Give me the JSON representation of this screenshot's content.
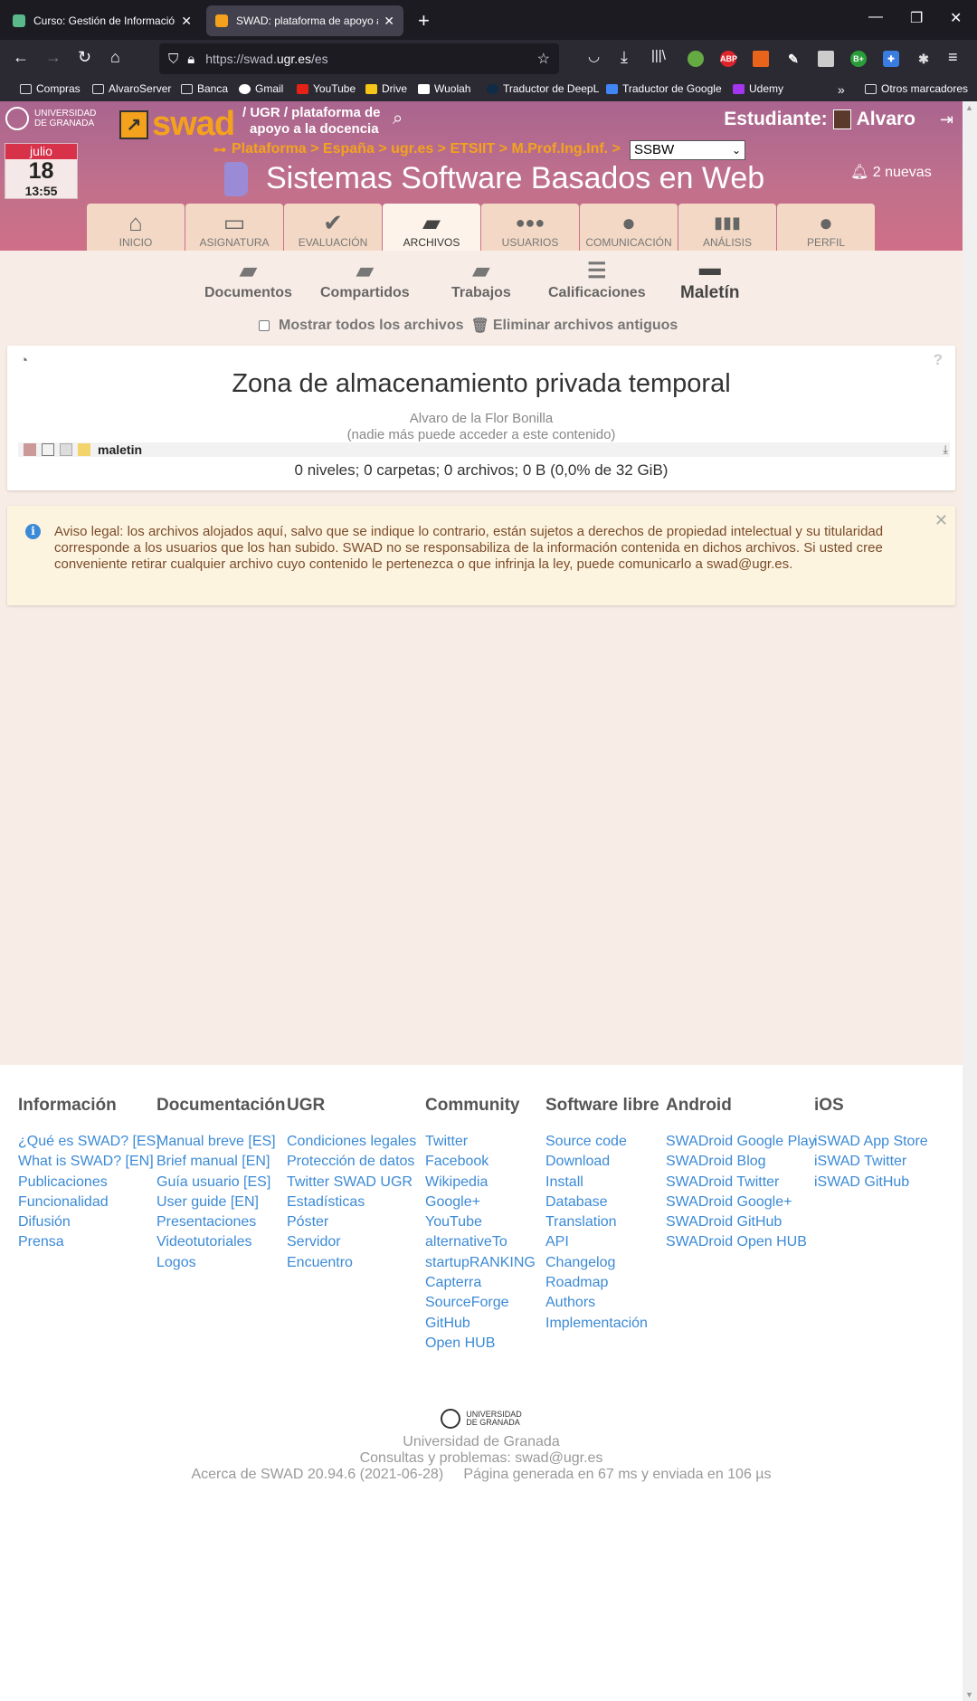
{
  "browser": {
    "tabs": [
      {
        "title": "Curso: Gestión de Información en",
        "favicon_color": "#5ab88a"
      },
      {
        "title": "SWAD: plataforma de apoyo a la doc",
        "favicon_color": "#f4a21d"
      }
    ],
    "url_prefix": "https://swad.",
    "url_domain": "ugr.es",
    "url_suffix": "/es",
    "bookmarks": [
      "Compras",
      "AlvaroServer",
      "Banca",
      "Gmail",
      "YouTube",
      "Drive",
      "Wuolah",
      "Traductor de DeepL",
      "Traductor de Google",
      "Udemy"
    ],
    "other_bookmarks": "Otros marcadores"
  },
  "header": {
    "university": "UNIVERSIDAD DE GRANADA",
    "university_l1": "UNIVERSIDAD",
    "university_l2": "DE GRANADA",
    "logo_word": "swad",
    "tagline_l1": "/ UGR / plataforma de",
    "tagline_l2": "apoyo a la docencia",
    "student_label": "Estudiante:",
    "student_name": "Alvaro",
    "calendar": {
      "month": "julio",
      "day": "18",
      "time": "13:55"
    },
    "breadcrumb": "Plataforma > España > ugr.es > ETSIIT > M.Prof.Ing.Inf. >",
    "course_select": "SSBW",
    "course_title": "Sistemas Software Basados en Web",
    "notifications": "2 nuevas"
  },
  "main_menu": [
    {
      "label": "INICIO",
      "icon": "home-icon",
      "glyph": "⌂"
    },
    {
      "label": "ASIGNATURA",
      "icon": "chalkboard-icon",
      "glyph": "▭"
    },
    {
      "label": "EVALUACIÓN",
      "icon": "check-icon",
      "glyph": "✔"
    },
    {
      "label": "ARCHIVOS",
      "icon": "folder-open-icon",
      "glyph": "▰"
    },
    {
      "label": "USUARIOS",
      "icon": "users-icon",
      "glyph": "●●"
    },
    {
      "label": "COMUNICACIÓN",
      "icon": "comment-icon",
      "glyph": "●"
    },
    {
      "label": "ANÁLISIS",
      "icon": "bar-chart-icon",
      "glyph": "▮▮"
    },
    {
      "label": "PERFIL",
      "icon": "user-icon",
      "glyph": "●"
    }
  ],
  "sub_menu": [
    {
      "label": "Documentos"
    },
    {
      "label": "Compartidos"
    },
    {
      "label": "Trabajos"
    },
    {
      "label": "Calificaciones"
    },
    {
      "label": "Maletín"
    }
  ],
  "options": {
    "show_all": "Mostrar todos los archivos",
    "delete_old": "Eliminar archivos antiguos"
  },
  "storage": {
    "title": "Zona de almacenamiento privada temporal",
    "owner": "Alvaro de la Flor Bonilla",
    "privacy": "(nadie más puede acceder a este contenido)",
    "root_folder": "maletin",
    "stats": "0 niveles; 0 carpetas; 0 archivos; 0 B (0,0% de 32 GiB)"
  },
  "legal": {
    "text": "Aviso legal: los archivos alojados aquí, salvo que se indique lo contrario, están sujetos a derechos de propiedad intelectual y su titularidad corresponde a los usuarios que los han subido. SWAD no se responsabiliza de la información contenida en dichos archivos. Si usted cree conveniente retirar cualquier archivo cuyo contenido le pertenezca o que infrinja la ley, puede comunicarlo a swad@ugr.es."
  },
  "footer": {
    "columns": [
      {
        "title": "Información",
        "links": [
          "¿Qué es SWAD? [ES]",
          "What is SWAD? [EN]",
          "Publicaciones",
          "Funcionalidad",
          "Difusión",
          "Prensa"
        ]
      },
      {
        "title": "Documentación",
        "links": [
          "Manual breve [ES]",
          "Brief manual [EN]",
          "Guía usuario [ES]",
          "User guide [EN]",
          "Presentaciones",
          "Videotutoriales",
          "Logos"
        ]
      },
      {
        "title": "UGR",
        "links": [
          "Condiciones legales",
          "Protección de datos",
          "Twitter SWAD UGR",
          "Estadísticas",
          "Póster",
          "Servidor",
          "Encuentro"
        ]
      },
      {
        "title": "Community",
        "links": [
          "Twitter",
          "Facebook",
          "Wikipedia",
          "Google+",
          "YouTube",
          "alternativeTo",
          "startupRANKING",
          "Capterra",
          "SourceForge",
          "GitHub",
          "Open HUB"
        ]
      },
      {
        "title": "Software libre",
        "links": [
          "Source code",
          "Download",
          "Install",
          "Database",
          "Translation",
          "API",
          "Changelog",
          "Roadmap",
          "Authors",
          "Implementación"
        ]
      },
      {
        "title": "Android",
        "links": [
          "SWADroid Google Play",
          "SWADroid Blog",
          "SWADroid Twitter",
          "SWADroid Google+",
          "SWADroid GitHub",
          "SWADroid Open HUB"
        ]
      },
      {
        "title": "iOS",
        "links": [
          "iSWAD App Store",
          "iSWAD Twitter",
          "iSWAD GitHub"
        ]
      }
    ],
    "uni_l1": "UNIVERSIDAD",
    "uni_l2": "DE GRANADA",
    "uni_name": "Universidad de Granada",
    "contact": "Consultas y problemas: swad@ugr.es",
    "about": "Acerca de SWAD 20.94.6 (2021-06-28)",
    "generated": "Página generada en 67 ms y enviada en 106 µs"
  }
}
